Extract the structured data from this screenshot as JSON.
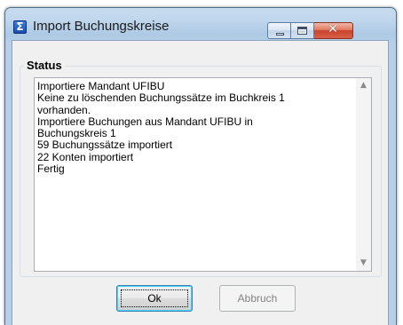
{
  "window": {
    "title": "Import Buchungskreise",
    "app_icon_glyph": "Σ",
    "caption_buttons": [
      "minimize",
      "maximize",
      "close"
    ]
  },
  "status_group": {
    "label": "Status",
    "lines": [
      "Importiere Mandant UFIBU",
      "Keine zu löschenden Buchungssätze im Buchkreis 1",
      "vorhanden.",
      "Importiere Buchungen aus Mandant UFIBU in",
      "Buchungskreis 1",
      "59 Buchungssätze importiert",
      "22 Konten importiert",
      "Fertig"
    ]
  },
  "buttons": {
    "ok_label": "Ok",
    "cancel_label": "Abbruch",
    "cancel_disabled": true
  },
  "icons": {
    "app": "sigma-icon",
    "minimize": "minimize-icon",
    "maximize": "maximize-icon",
    "close": "close-icon",
    "scroll_up": "scroll-up-arrow-icon",
    "scroll_down": "scroll-down-arrow-icon"
  }
}
